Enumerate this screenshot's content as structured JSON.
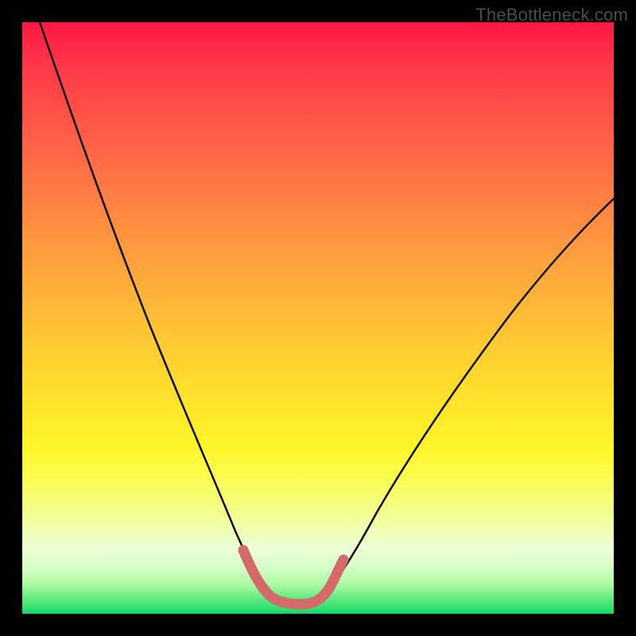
{
  "watermark": "TheBottleneck.com",
  "chart_data": {
    "type": "line",
    "title": "",
    "xlabel": "",
    "ylabel": "",
    "xlim": [
      0,
      100
    ],
    "ylim": [
      0,
      100
    ],
    "grid": false,
    "legend": false,
    "series": [
      {
        "name": "left-curve",
        "x": [
          3,
          6,
          10,
          14,
          18,
          22,
          26,
          30,
          32,
          34,
          36,
          38,
          40,
          41
        ],
        "values": [
          100,
          91,
          80,
          70,
          60,
          50,
          40,
          30,
          24,
          18,
          12,
          8,
          5,
          4
        ],
        "color": "#000000"
      },
      {
        "name": "right-curve",
        "x": [
          48,
          50,
          52,
          55,
          60,
          66,
          72,
          78,
          84,
          90,
          96,
          100
        ],
        "values": [
          4,
          6,
          9,
          14,
          22,
          30,
          38,
          45,
          52,
          58,
          64,
          68
        ],
        "color": "#000000"
      },
      {
        "name": "valley-highlight",
        "x": [
          36,
          38,
          40,
          42,
          44,
          46,
          48,
          50,
          52
        ],
        "values": [
          11,
          7,
          5,
          4,
          4,
          4,
          5,
          7,
          9
        ],
        "color": "#d46a6a"
      }
    ],
    "gradient_stops": [
      {
        "y": 100,
        "color": "#ff1846"
      },
      {
        "y": 50,
        "color": "#ffc033"
      },
      {
        "y": 20,
        "color": "#fdf64a"
      },
      {
        "y": 5,
        "color": "#c9ffb0"
      },
      {
        "y": 0,
        "color": "#17d96a"
      }
    ]
  }
}
